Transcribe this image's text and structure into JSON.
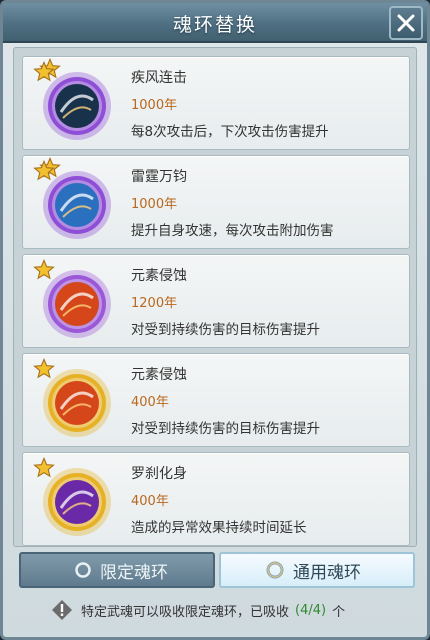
{
  "header": {
    "title": "魂环替换"
  },
  "skills": [
    {
      "name": "疾风连击",
      "years": "1000年",
      "desc": "每8次攻击后，下次攻击伤害提升",
      "stars": 2,
      "ring": "#8e4fd6",
      "core": "#18324c"
    },
    {
      "name": "雷霆万钧",
      "years": "1000年",
      "desc": "提升自身攻速，每次攻击附加伤害",
      "stars": 2,
      "ring": "#8e4fd6",
      "core": "#2b6fbf"
    },
    {
      "name": "元素侵蚀",
      "years": "1200年",
      "desc": "对受到持续伤害的目标伤害提升",
      "stars": 1,
      "ring": "#9b58d8",
      "core": "#d5461a"
    },
    {
      "name": "元素侵蚀",
      "years": "400年",
      "desc": "对受到持续伤害的目标伤害提升",
      "stars": 1,
      "ring": "#e6b125",
      "core": "#d5461a"
    },
    {
      "name": "罗刹化身",
      "years": "400年",
      "desc": "造成的异常效果持续时间延长",
      "stars": 1,
      "ring": "#e6b125",
      "core": "#6a2aa8"
    }
  ],
  "tabs": {
    "limited": "限定魂环",
    "general": "通用魂环"
  },
  "notice": {
    "text": "特定武魂可以吸收限定魂环，已吸收",
    "count": "(4/4)",
    "unit": "个"
  },
  "colors": {
    "header": "#4f6f83",
    "accent_orange": "#b9681d",
    "count_green": "#2e8a2e"
  }
}
